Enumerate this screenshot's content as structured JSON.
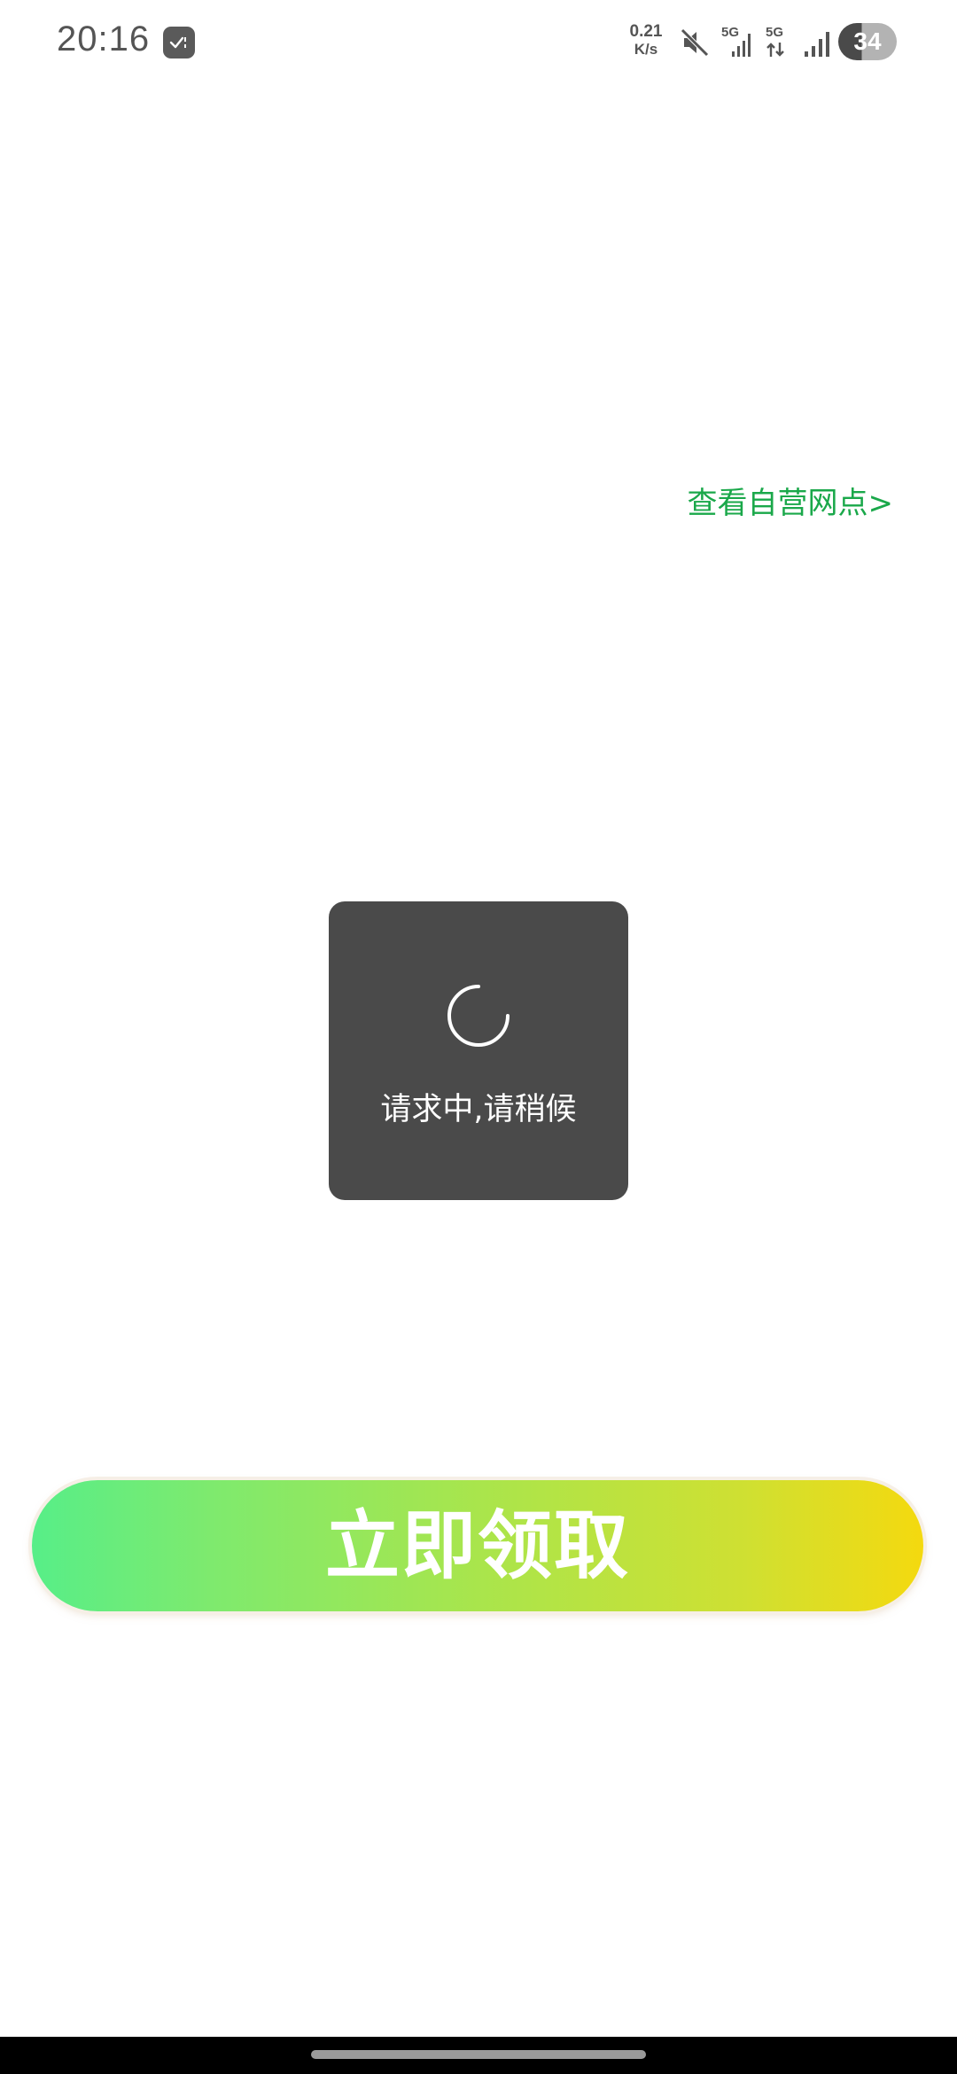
{
  "status_bar": {
    "time": "20:16",
    "net_speed_value": "0.21",
    "net_speed_unit": "K/s",
    "sim1_label": "5G",
    "sim2_label": "5G",
    "battery_level": "34",
    "icons": [
      "notification-icon",
      "mute-icon",
      "signal-5g-icon",
      "signal-5g-data-icon",
      "signal-icon",
      "battery-icon"
    ]
  },
  "main": {
    "outlet_link": "查看自营网点>",
    "link_color": "#1aa84a"
  },
  "loading_toast": {
    "message": "请求中,请稍候",
    "background": "#4a4a4a"
  },
  "claim_button": {
    "label": "立即领取",
    "gradient_start": "#57ee88",
    "gradient_end": "#f4d90f"
  }
}
